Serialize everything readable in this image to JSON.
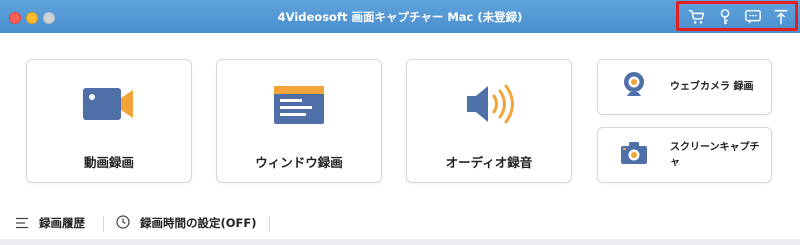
{
  "window": {
    "title": "4Videosoft 画面キャプチャー Mac (未登録)",
    "accent_color": "#4d8fcc",
    "highlight_color": "#e32020"
  },
  "titlebar_tools": [
    {
      "icon": "cart-icon"
    },
    {
      "icon": "key-icon"
    },
    {
      "icon": "chat-icon"
    },
    {
      "icon": "pin-icon"
    }
  ],
  "main": {
    "cards": [
      {
        "id": "video",
        "label": "動画録画",
        "icon": "video-camera-icon"
      },
      {
        "id": "window",
        "label": "ウィンドウ録画",
        "icon": "window-icon"
      },
      {
        "id": "audio",
        "label": "オーディオ録音",
        "icon": "speaker-icon"
      }
    ],
    "side_cards": [
      {
        "id": "webcam",
        "label": "ウェブカメラ 録画",
        "icon": "webcam-icon"
      },
      {
        "id": "screenshot",
        "label": "スクリーンキャプチャ",
        "icon": "camera-icon"
      }
    ]
  },
  "bottombar": {
    "history_label": "録画履歴",
    "timer_label": "録画時間の設定(OFF)"
  }
}
